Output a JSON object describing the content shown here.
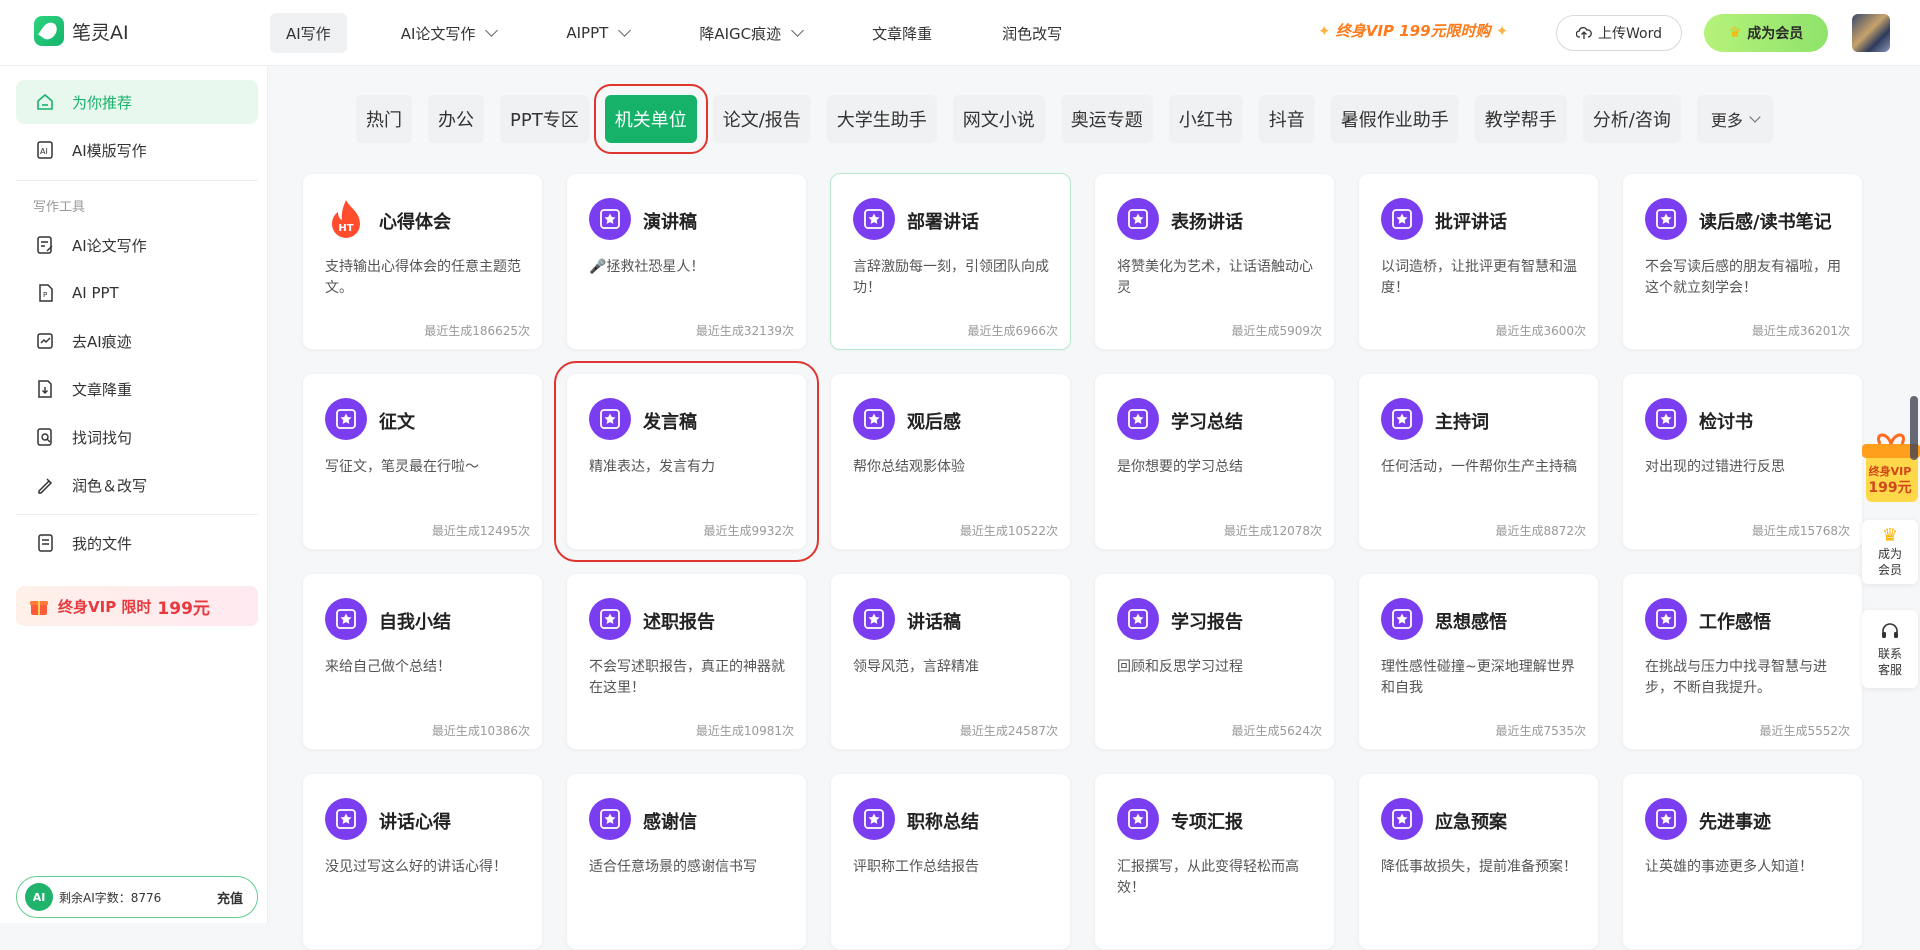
{
  "app": {
    "logo_text": "笔灵AI"
  },
  "nav": [
    {
      "label": "AI写作",
      "dropdown": false,
      "active": true
    },
    {
      "label": "AI论文写作",
      "dropdown": true
    },
    {
      "label": "AIPPT",
      "dropdown": true
    },
    {
      "label": "降AIGC痕迹",
      "dropdown": true
    },
    {
      "label": "文章降重",
      "dropdown": false
    },
    {
      "label": "润色改写",
      "dropdown": false
    }
  ],
  "header": {
    "vip_promo": "终身VIP 199元限时购",
    "upload_label": "上传Word",
    "member_label": "成为会员"
  },
  "sidebar": {
    "items": [
      {
        "label": "为你推荐",
        "icon": "home-icon",
        "active": true
      },
      {
        "label": "AI模版写作",
        "icon": "ai-template-icon"
      }
    ],
    "section_title": "写作工具",
    "tools": [
      {
        "label": "AI论文写作",
        "icon": "paper-edit-icon"
      },
      {
        "label": "AI PPT",
        "icon": "ppt-icon"
      },
      {
        "label": "去AI痕迹",
        "icon": "ai-trace-icon"
      },
      {
        "label": "文章降重",
        "icon": "rewrite-icon"
      },
      {
        "label": "找词找句",
        "icon": "find-word-icon"
      },
      {
        "label": "润色＆改写",
        "icon": "polish-icon"
      }
    ],
    "my_files": "我的文件",
    "vip_text": "终身VIP 限时",
    "vip_price": "199元",
    "credit_badge": "AI",
    "credit_text": "剩余AI字数：8776",
    "recharge": "充值"
  },
  "tabs": [
    "热门",
    "办公",
    "PPT专区",
    "机关单位",
    "论文/报告",
    "大学生助手",
    "网文小说",
    "奥运专题",
    "小红书",
    "抖音",
    "暑假作业助手",
    "教学帮手",
    "分析/咨询"
  ],
  "tabs_active": "机关单位",
  "tabs_more": "更多",
  "cards": [
    {
      "title": "心得体会",
      "desc": "支持输出心得体会的任意主题范文。",
      "count": "最近生成186625次",
      "icon": "fire-icon",
      "badge": "HT"
    },
    {
      "title": "演讲稿",
      "desc": "🎤拯救社恐星人！",
      "count": "最近生成32139次",
      "icon": "star-icon"
    },
    {
      "title": "部署讲话",
      "desc": "言辞激励每一刻，引领团队向成功！",
      "count": "最近生成6966次",
      "icon": "star-icon",
      "highlight": true
    },
    {
      "title": "表扬讲话",
      "desc": "将赞美化为艺术，让话语触动心灵",
      "count": "最近生成5909次",
      "icon": "star-icon"
    },
    {
      "title": "批评讲话",
      "desc": "以词造桥，让批评更有智慧和温度！",
      "count": "最近生成3600次",
      "icon": "star-icon"
    },
    {
      "title": "读后感/读书笔记",
      "desc": "不会写读后感的朋友有福啦，用这个就立刻学会！",
      "count": "最近生成36201次",
      "icon": "star-icon"
    },
    {
      "title": "征文",
      "desc": "写征文，笔灵最在行啦～",
      "count": "最近生成12495次",
      "icon": "star-icon"
    },
    {
      "title": "发言稿",
      "desc": "精准表达，发言有力",
      "count": "最近生成9932次",
      "icon": "star-icon",
      "selected": true
    },
    {
      "title": "观后感",
      "desc": "帮你总结观影体验",
      "count": "最近生成10522次",
      "icon": "star-icon"
    },
    {
      "title": "学习总结",
      "desc": "是你想要的学习总结",
      "count": "最近生成12078次",
      "icon": "star-icon"
    },
    {
      "title": "主持词",
      "desc": "任何活动，一件帮你生产主持稿",
      "count": "最近生成8872次",
      "icon": "star-icon"
    },
    {
      "title": "检讨书",
      "desc": "对出现的过错进行反思",
      "count": "最近生成15768次",
      "icon": "star-icon"
    },
    {
      "title": "自我小结",
      "desc": "来给自己做个总结！",
      "count": "最近生成10386次",
      "icon": "star-icon"
    },
    {
      "title": "述职报告",
      "desc": "不会写述职报告，真正的神器就在这里！",
      "count": "最近生成10981次",
      "icon": "star-icon"
    },
    {
      "title": "讲话稿",
      "desc": "领导风范，言辞精准",
      "count": "最近生成24587次",
      "icon": "star-icon"
    },
    {
      "title": "学习报告",
      "desc": "回顾和反思学习过程",
      "count": "最近生成5624次",
      "icon": "star-icon"
    },
    {
      "title": "思想感悟",
      "desc": "理性感性碰撞~更深地理解世界和自我",
      "count": "最近生成7535次",
      "icon": "star-icon"
    },
    {
      "title": "工作感悟",
      "desc": "在挑战与压力中找寻智慧与进步，不断自我提升。",
      "count": "最近生成5552次",
      "icon": "star-icon"
    },
    {
      "title": "讲话心得",
      "desc": "没见过写这么好的讲话心得！",
      "count": "",
      "icon": "star-icon"
    },
    {
      "title": "感谢信",
      "desc": "适合任意场景的感谢信书写",
      "count": "",
      "icon": "star-icon"
    },
    {
      "title": "职称总结",
      "desc": "评职称工作总结报告",
      "count": "",
      "icon": "star-icon"
    },
    {
      "title": "专项汇报",
      "desc": "汇报撰写，从此变得轻松而高效！",
      "count": "",
      "icon": "star-icon"
    },
    {
      "title": "应急预案",
      "desc": "降低事故损失，提前准备预案！",
      "count": "",
      "icon": "star-icon"
    },
    {
      "title": "先进事迹",
      "desc": "让英雄的事迹更多人知道！",
      "count": "",
      "icon": "star-icon"
    }
  ],
  "float": {
    "promo_line1": "终身VIP",
    "promo_line2": "199元",
    "member": "成为会员",
    "support": "联系客服"
  },
  "colors": {
    "brand": "#17b26a",
    "icon": "#7a3ef0",
    "vip": "#e8393e",
    "highlight_box": "#e0352f"
  }
}
